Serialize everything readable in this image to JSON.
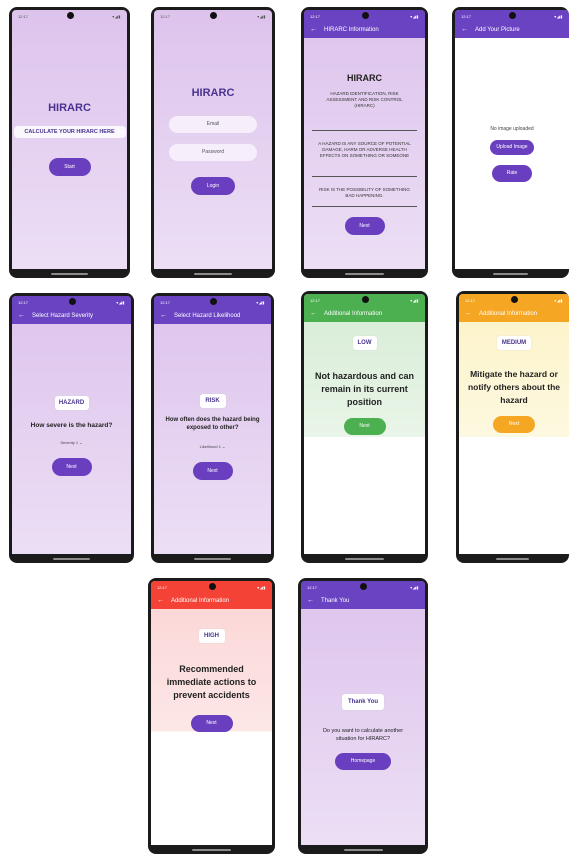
{
  "status": {
    "time": "12:17",
    "icons": "▾◢▮"
  },
  "s1": {
    "title": "HIRARC",
    "banner": "CALCULATE YOUR HIRARC HERE",
    "button": "Start"
  },
  "s2": {
    "title": "HIRARC",
    "email_placeholder": "Email",
    "password_placeholder": "Password",
    "button": "Login"
  },
  "s3": {
    "appbar": "HIRARC Information",
    "title": "HIRARC",
    "subtitle": "HAZARD IDENTIFICATION, RISK ASSESSMENT AND RISK CONTROL (HIRARC)",
    "hazard_def": "A HAZARD IS ANY SOURCE OF POTENTIAL DAMAGE, HARM OR ADVERSE HEALTH EFFECTS ON SOMETHING OR SOMEONE",
    "risk_def": "RISK IS THE POSSIBILITY OF SOMETHING BAD HAPPENING.",
    "button": "Next"
  },
  "s4": {
    "appbar": "Add Your Picture",
    "no_image": "No image uploaded",
    "upload": "Upload Image",
    "rate": "Rate"
  },
  "s5": {
    "appbar": "Select Hazard Severity",
    "tag": "HAZARD",
    "question": "How severe is the hazard?",
    "dropdown": "Severity 1",
    "button": "Next"
  },
  "s6": {
    "appbar": "Select Hazard Likelihood",
    "tag": "RISK",
    "question": "How often does the hazard being exposed to other?",
    "dropdown": "Likelihood 1",
    "button": "Next"
  },
  "s7": {
    "appbar": "Additional Information",
    "tag": "LOW",
    "message": "Not hazardous and can remain in its current position",
    "button": "Next"
  },
  "s8": {
    "appbar": "Additional Information",
    "tag": "MEDIUM",
    "message": "Mitigate the hazard or notify others about the hazard",
    "button": "Next"
  },
  "s9": {
    "appbar": "Additional Information",
    "tag": "HIGH",
    "message": "Recommended immediate actions to prevent accidents",
    "button": "Next"
  },
  "s10": {
    "appbar": "Thank You",
    "tag": "Thank You",
    "question": "Do you want to calculate another situation for HIRARC?",
    "button": "Homepage"
  },
  "colors": {
    "purple": "#6a43c2",
    "green": "#4caf50",
    "orange": "#f5a623",
    "red": "#f44336"
  }
}
